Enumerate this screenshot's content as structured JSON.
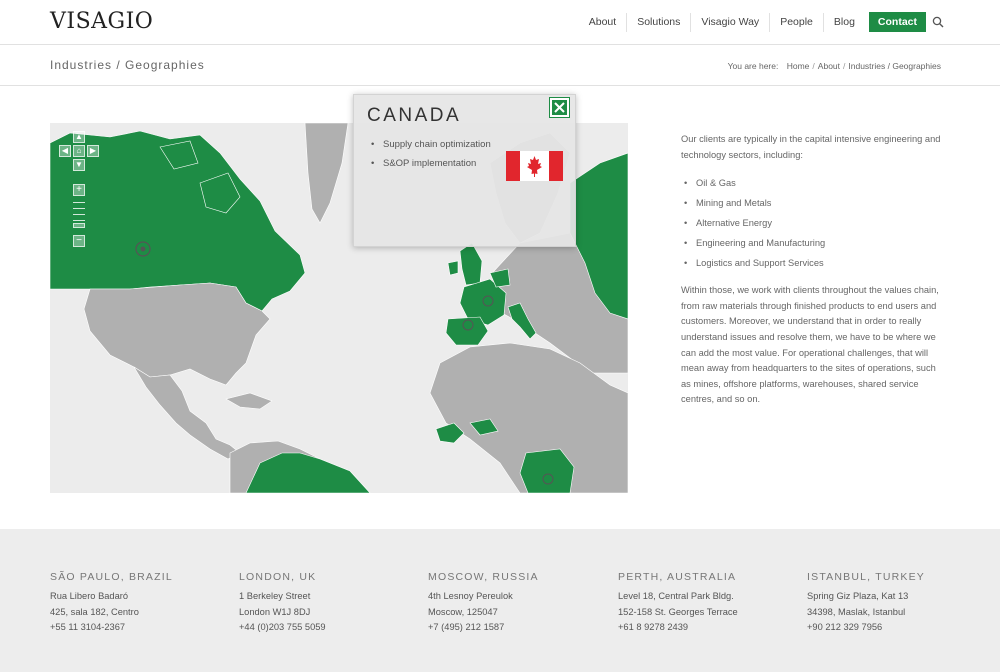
{
  "header": {
    "logo": "VISAGIO",
    "nav": [
      "About",
      "Solutions",
      "Visagio Way",
      "People",
      "Blog"
    ],
    "contact": "Contact"
  },
  "titlebar": {
    "title": "Industries / Geographies",
    "you_are_here": "You are here:",
    "crumbs": [
      "Home",
      "About",
      "Industries / Geographies"
    ]
  },
  "popup": {
    "title": "CANADA",
    "items": [
      "Supply chain optimization",
      "S&OP implementation"
    ]
  },
  "side": {
    "intro": "Our clients are typically in the capital intensive engineering and technology sectors, including:",
    "sectors": [
      "Oil & Gas",
      "Mining and Metals",
      "Alternative Energy",
      "Engineering and Manufacturing",
      "Logistics and Support Services"
    ],
    "body": "Within those, we work with clients throughout the values chain, from raw materials through finished products to end users and customers.  Moreover, we understand that in order to really understand issues and resolve them, we have to be where we can add the most value.  For operational challenges, that will mean away from headquarters to the sites of operations, such as mines, offshore platforms, warehouses, shared service centres, and so on."
  },
  "offices": [
    {
      "city": "SÃO PAULO, BRAZIL",
      "lines": [
        "Rua Libero Badaró",
        "425, sala 182, Centro",
        "+55 11 3104-2367"
      ]
    },
    {
      "city": "LONDON, UK",
      "lines": [
        "1 Berkeley Street",
        "London W1J 8DJ",
        "+44 (0)203 755 5059"
      ]
    },
    {
      "city": "MOSCOW, RUSSIA",
      "lines": [
        "4th Lesnoy Pereulok",
        "Moscow, 125047",
        "+7 (495) 212 1587"
      ]
    },
    {
      "city": "PERTH, AUSTRALIA",
      "lines": [
        "Level 18, Central Park Bldg.",
        "152-158 St. Georges Terrace",
        "+61 8 9278 2439"
      ]
    },
    {
      "city": "ISTANBUL, TURKEY",
      "lines": [
        "Spring Giz Plaza, Kat 13",
        "34398, Maslak, Istanbul",
        "+90 212 329 7956"
      ]
    }
  ],
  "colors": {
    "accent": "#1e8c45",
    "land_gray": "#b0b0b0",
    "ocean": "#ececec",
    "footer_bg": "#ededed"
  }
}
